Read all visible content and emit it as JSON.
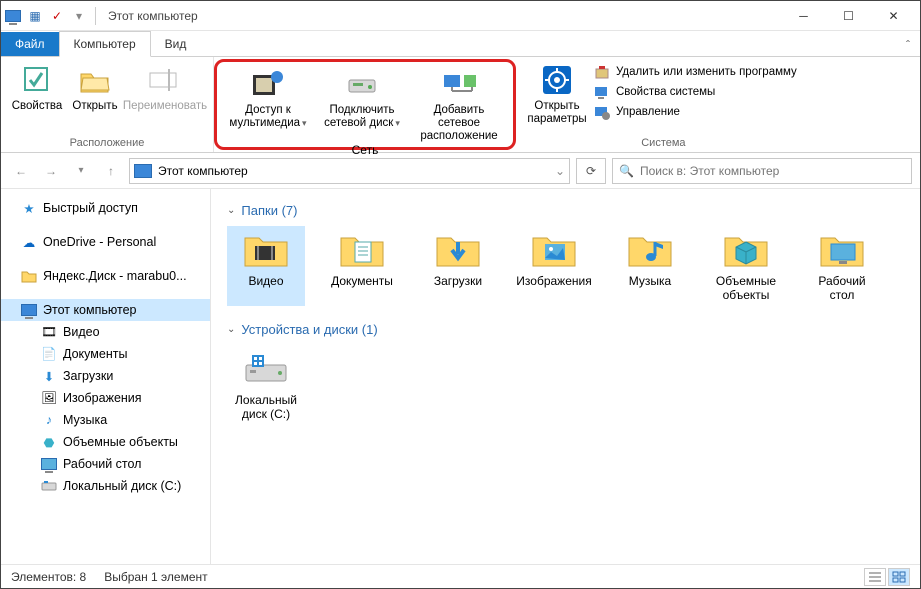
{
  "window": {
    "title": "Этот компьютер"
  },
  "tabs": {
    "file": "Файл",
    "computer": "Компьютер",
    "view": "Вид"
  },
  "ribbon": {
    "location": {
      "label": "Расположение",
      "properties": "Свойства",
      "open": "Открыть",
      "rename": "Переименовать"
    },
    "network": {
      "label": "Сеть",
      "media": "Доступ к мультимедиа",
      "mapdrive": "Подключить сетевой диск",
      "addloc": "Добавить сетевое расположение"
    },
    "system": {
      "label": "Система",
      "settings": "Открыть параметры",
      "uninstall": "Удалить или изменить программу",
      "sysprops": "Свойства системы",
      "manage": "Управление"
    }
  },
  "address": {
    "path": "Этот компьютер",
    "search_placeholder": "Поиск в: Этот компьютер"
  },
  "sidebar": {
    "quick": "Быстрый доступ",
    "onedrive": "OneDrive - Personal",
    "yadisk": "Яндекс.Диск - marabu0...",
    "thispc": "Этот компьютер",
    "children": {
      "videos": "Видео",
      "documents": "Документы",
      "downloads": "Загрузки",
      "pictures": "Изображения",
      "music": "Музыка",
      "objects3d": "Объемные объекты",
      "desktop": "Рабочий стол",
      "localdisk": "Локальный диск (C:)"
    }
  },
  "content": {
    "folders_hdr": "Папки (7)",
    "devices_hdr": "Устройства и диски (1)",
    "folders": {
      "videos": "Видео",
      "documents": "Документы",
      "downloads": "Загрузки",
      "pictures": "Изображения",
      "music": "Музыка",
      "objects3d": "Объемные объекты",
      "desktop": "Рабочий стол"
    },
    "drives": {
      "c": "Локальный диск (C:)"
    }
  },
  "status": {
    "count": "Элементов: 8",
    "selected": "Выбран 1 элемент"
  }
}
